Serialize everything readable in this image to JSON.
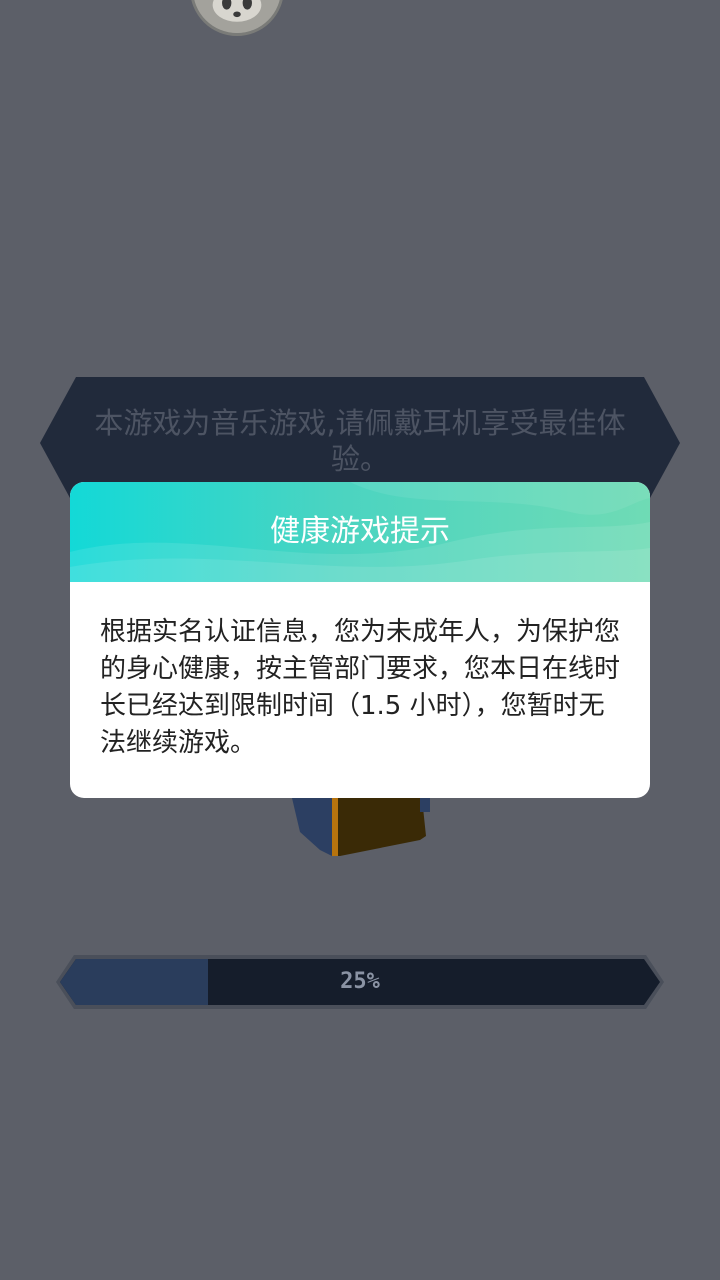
{
  "tip": {
    "text": "本游戏为音乐游戏,请佩戴耳机享受最佳体验。"
  },
  "loading": {
    "progress_percent": 25,
    "label": "25%"
  },
  "dialog": {
    "title": "健康游戏提示",
    "message": "根据实名认证信息，您为未成年人，为保护您的身心健康，按主管部门要求，您本日在线时长已经达到限制时间（1.5 小时），您暂时无法继续游戏。"
  },
  "colors": {
    "background": "#5c5f68",
    "banner": "#212a3b",
    "progress_fill": "#2a3d5c",
    "progress_track": "#151d2b",
    "dialog_header_start": "#13d9d7",
    "dialog_header_end": "#6fdbb5"
  },
  "icons": {
    "avatar": "panda-avatar-icon"
  }
}
